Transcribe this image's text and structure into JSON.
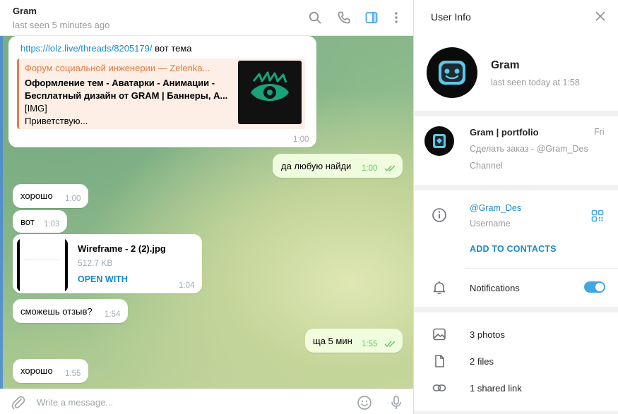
{
  "chat": {
    "title": "Gram",
    "status": "last seen 5 minutes ago",
    "icons": [
      "search-icon",
      "phone-icon",
      "sidebar-toggle-icon",
      "more-vertical-icon"
    ],
    "messages": {
      "m1": {
        "link": "https://lolz.live/threads/8205179/",
        "text": " вот тема",
        "preview_site": "Форум социальной инженерии — Zelenka...",
        "preview_line1": "Оформление тем - Аватарки - Анимации -",
        "preview_line2": "Бесплатный дизайн от GRAM | Баннеры, А...",
        "preview_line3": "[IMG]",
        "preview_line4": "Приветствую...",
        "time": "1:00"
      },
      "m2": {
        "text": "да любую найди",
        "time": "1:00"
      },
      "m3": {
        "text": "хорошо",
        "time": "1:00"
      },
      "m4": {
        "text": "вот",
        "time": "1:03"
      },
      "m5": {
        "file_name": "Wireframe - 2 (2).jpg",
        "file_size": "512.7 KB",
        "action": "OPEN WITH",
        "time": "1:04"
      },
      "m6": {
        "text": "сможешь отзыв?",
        "time": "1:54"
      },
      "m7": {
        "text": "ща 5 мин",
        "time": "1:55"
      },
      "m8": {
        "text": "хорошо",
        "time": "1:55"
      }
    },
    "composer": {
      "placeholder": "Write a message..."
    }
  },
  "info": {
    "title": "User Info",
    "name": "Gram",
    "seen": "last seen today at 1:58",
    "channel": {
      "name": "Gram | portfolio",
      "date": "Fri",
      "last_message": "Сделать заказ -  @Gram_Des",
      "kind": "Channel"
    },
    "username": "@Gram_Des",
    "username_label": "Username",
    "add_contact": "ADD TO CONTACTS",
    "notifications": "Notifications",
    "notifications_on": true,
    "photos": "3 photos",
    "files": "2 files",
    "links": "1 shared link"
  },
  "colors": {
    "accent": "#168acd",
    "toggle": "#40a7e3",
    "outgoing_bubble": "#effdde",
    "preview_accent": "#e17f4b"
  }
}
